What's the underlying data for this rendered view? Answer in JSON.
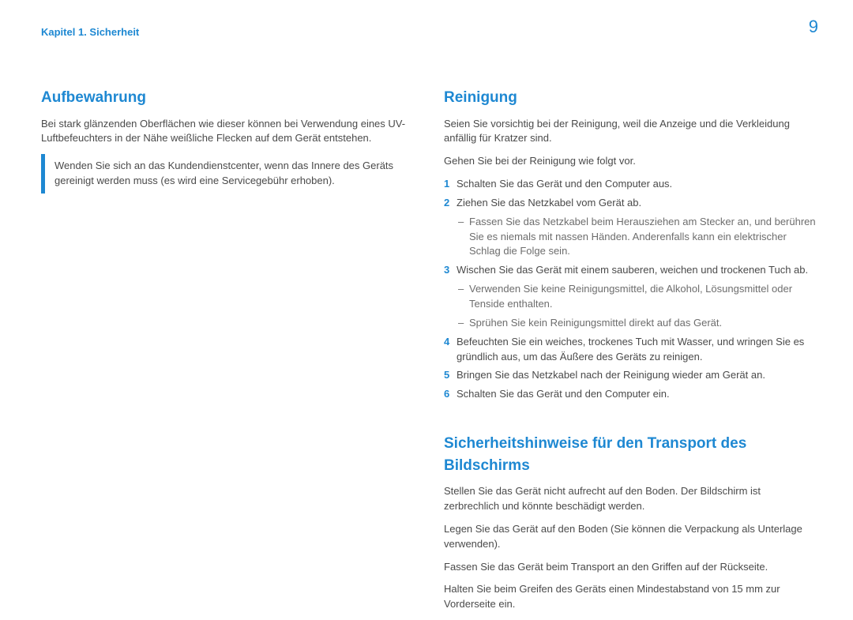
{
  "header": {
    "chapter": "Kapitel 1. Sicherheit",
    "page_number": "9"
  },
  "left": {
    "heading": "Aufbewahrung",
    "para1": "Bei stark glänzenden Oberflächen wie dieser können bei Verwendung eines UV-Luftbefeuchters in der Nähe weißliche Flecken auf dem Gerät entstehen.",
    "note": "Wenden Sie sich an das Kundendienstcenter, wenn das Innere des Geräts gereinigt werden muss (es wird eine Servicegebühr erhoben)."
  },
  "right": {
    "heading1": "Reinigung",
    "para1": "Seien Sie vorsichtig bei der Reinigung, weil die Anzeige und die Verkleidung anfällig für Kratzer sind.",
    "para2": "Gehen Sie bei der Reinigung wie folgt vor.",
    "steps": [
      {
        "n": "1",
        "text": "Schalten Sie das Gerät und den Computer aus."
      },
      {
        "n": "2",
        "text": "Ziehen Sie das Netzkabel vom Gerät ab."
      },
      {
        "n": "",
        "text": ""
      },
      {
        "n": "3",
        "text": "Wischen Sie das Gerät mit einem sauberen, weichen und trockenen Tuch ab."
      },
      {
        "n": "4",
        "text": "Befeuchten Sie ein weiches, trockenes Tuch mit Wasser, und wringen Sie es gründlich aus, um das Äußere des Geräts zu reinigen."
      },
      {
        "n": "5",
        "text": "Bringen Sie das Netzkabel nach der Reinigung wieder am Gerät an."
      },
      {
        "n": "6",
        "text": "Schalten Sie das Gerät und den Computer ein."
      }
    ],
    "sub2a": "Fassen Sie das Netzkabel beim Herausziehen am Stecker an, und berühren Sie es niemals mit nassen Händen. Anderenfalls kann ein elektrischer Schlag die Folge sein.",
    "sub3a": "Verwenden Sie keine Reinigungsmittel, die Alkohol, Lösungsmittel oder Tenside enthalten.",
    "sub3b": "Sprühen Sie kein Reinigungsmittel direkt auf das Gerät.",
    "heading2": "Sicherheitshinweise für den Transport des Bildschirms",
    "t1": "Stellen Sie das Gerät nicht aufrecht auf den Boden. Der Bildschirm ist zerbrechlich und könnte beschädigt werden.",
    "t2": "Legen Sie das Gerät auf den Boden (Sie können die Verpackung als Unterlage verwenden).",
    "t3": "Fassen Sie das Gerät beim Transport an den Griffen auf der Rückseite.",
    "t4": "Halten Sie beim Greifen des Geräts einen Mindestabstand von 15 mm zur Vorderseite ein."
  }
}
